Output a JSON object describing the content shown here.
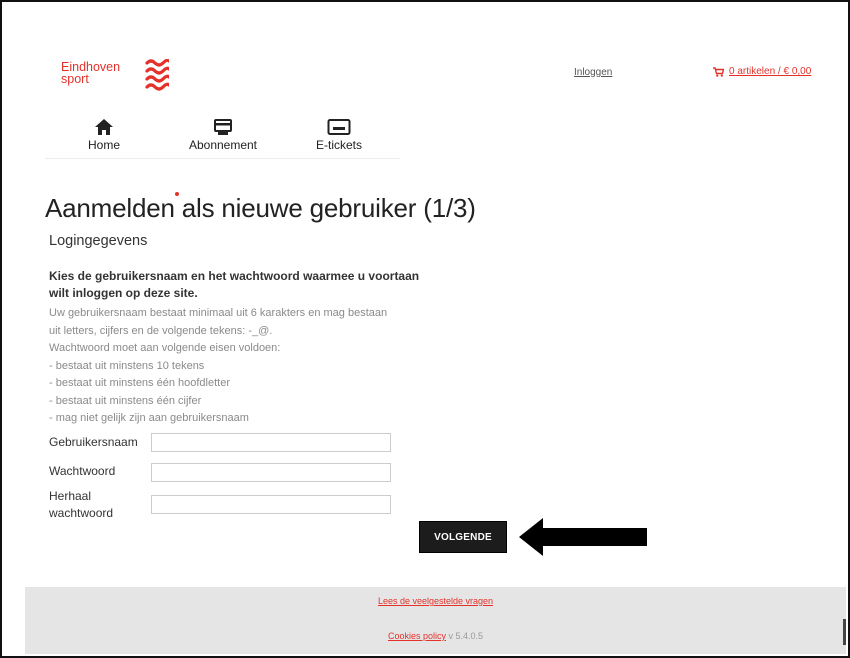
{
  "header": {
    "logo_line1": "Eindhoven",
    "logo_line2": "sport",
    "login_link": "Inloggen",
    "cart_label": "0 artikelen / € 0,00"
  },
  "nav": {
    "items": [
      {
        "label": "Home",
        "icon": "home-icon"
      },
      {
        "label": "Abonnement",
        "icon": "card-icon"
      },
      {
        "label": "E-tickets",
        "icon": "ticket-icon"
      }
    ]
  },
  "page": {
    "title": "Aanmelden als nieuwe gebruiker (1/3)",
    "subtitle": "Logingegevens",
    "intro_line1": "Kies de gebruikersnaam en het wachtwoord waarmee u voortaan",
    "intro_line2": "wilt inloggen op deze site.",
    "rules": [
      "Uw gebruikersnaam bestaat minimaal uit 6 karakters en mag bestaan",
      "uit letters, cijfers en de volgende tekens: -_@.",
      "Wachtwoord moet aan volgende eisen voldoen:",
      "- bestaat uit minstens 10 tekens",
      "- bestaat uit minstens één hoofdletter",
      "- bestaat uit minstens één cijfer",
      "- mag niet gelijk zijn aan gebruikersnaam"
    ]
  },
  "form": {
    "username_label": "Gebruikersnaam",
    "username_value": "",
    "password_label": "Wachtwoord",
    "password_value": "",
    "repeat_label_line1": "Herhaal",
    "repeat_label_line2": "wachtwoord",
    "repeat_value": "",
    "submit_label": "VOLGENDE"
  },
  "footer": {
    "faq_link": "Lees de veelgestelde vragen",
    "cookies_link": "Cookies policy",
    "version": " v 5.4.0.5"
  },
  "colors": {
    "brand": "#e4322b",
    "button": "#1c1c1c",
    "footer_bg": "#e5e5e5"
  }
}
